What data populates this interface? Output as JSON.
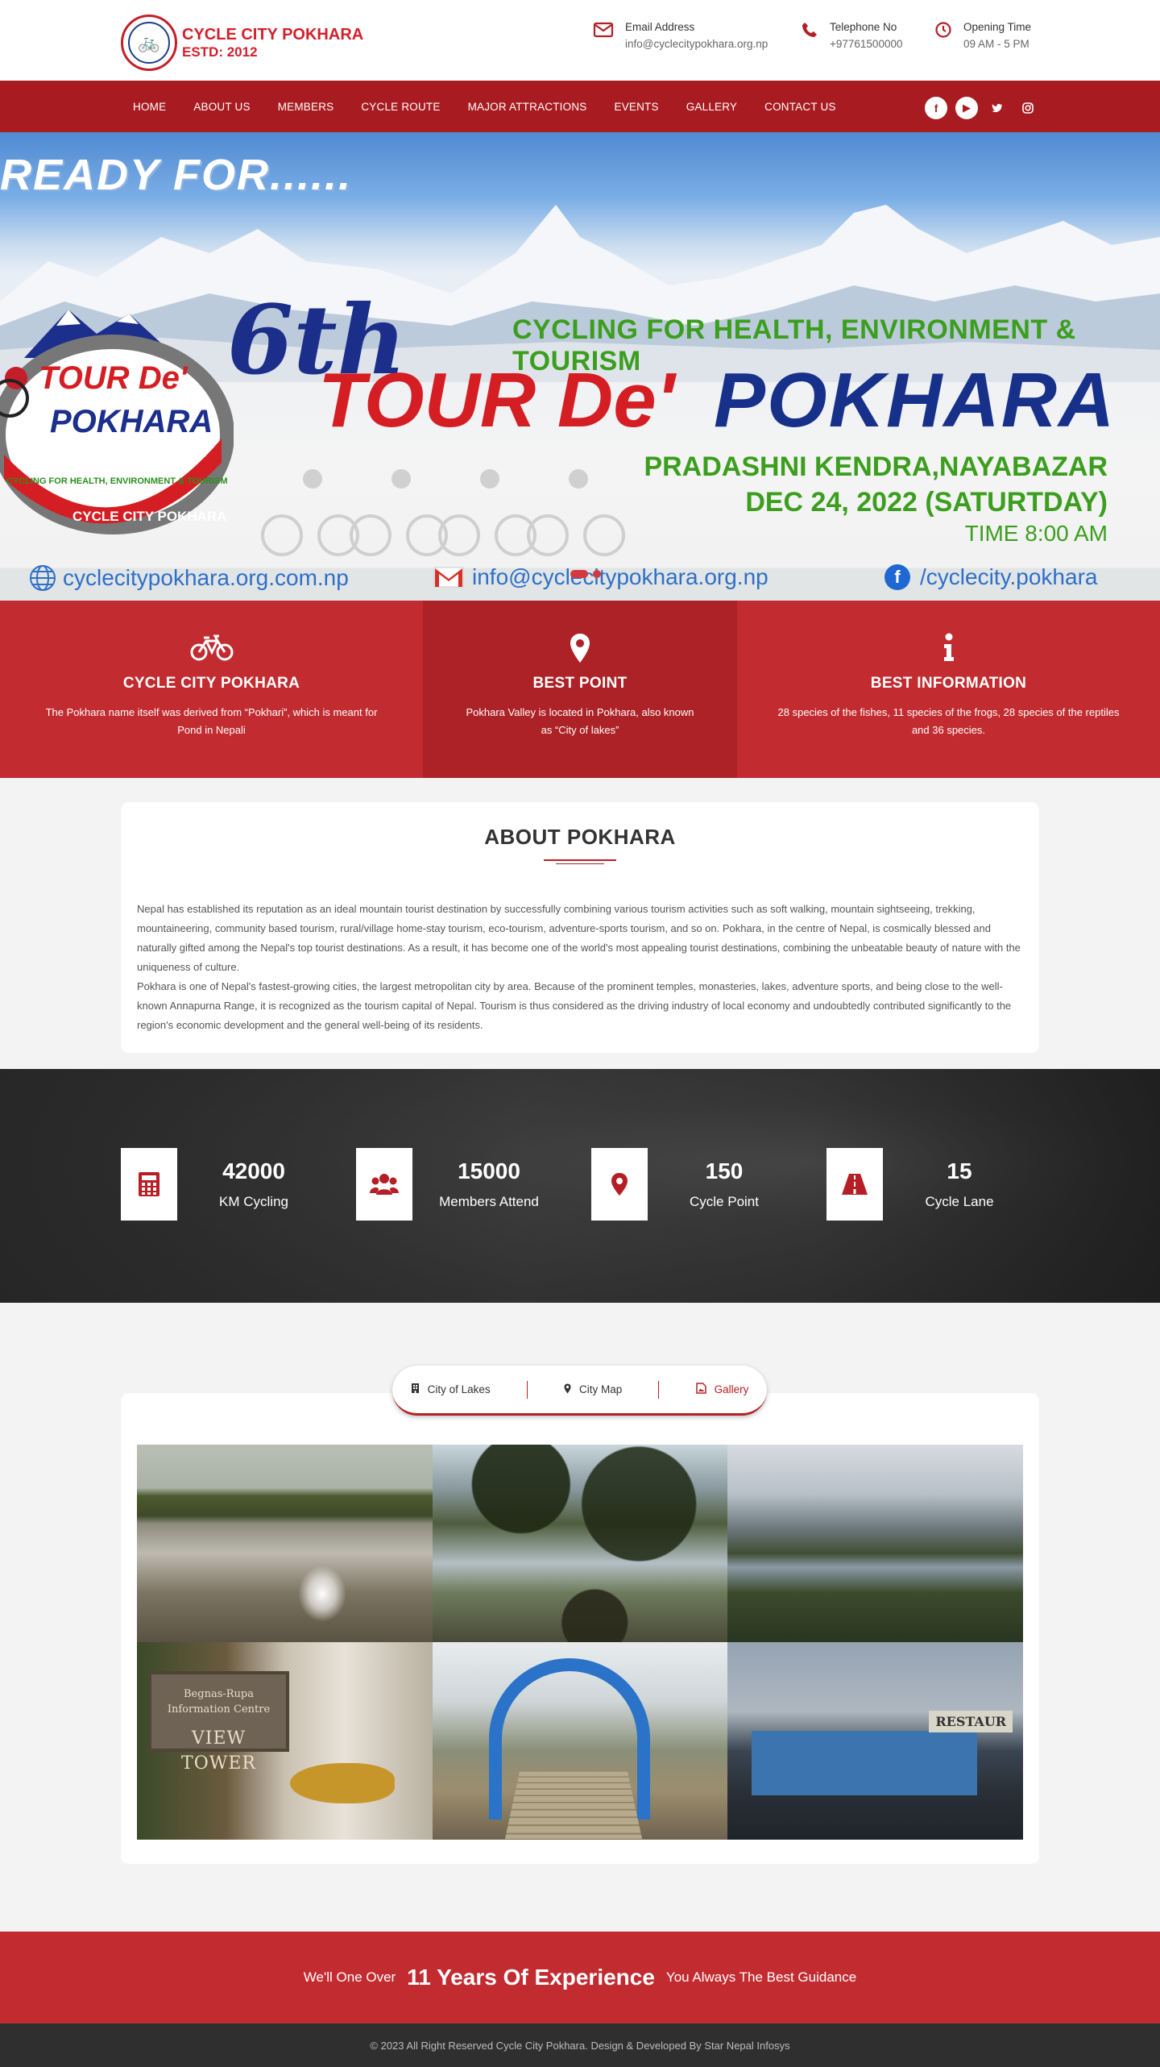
{
  "header": {
    "logo_line1": "CYCLE CITY POKHARA",
    "logo_line2": "ESTD: 2012",
    "contacts": [
      {
        "icon": "envelope-icon",
        "title": "Email Address",
        "value": "info@cyclecitypokhara.org.np"
      },
      {
        "icon": "phone-icon",
        "title": "Telephone No",
        "value": "+97761500000"
      },
      {
        "icon": "clock-icon",
        "title": "Opening Time",
        "value": "09 AM - 5 PM"
      }
    ]
  },
  "nav": {
    "items": [
      "HOME",
      "ABOUT US",
      "MEMBERS",
      "CYCLE ROUTE",
      "MAJOR ATTRACTIONS",
      "EVENTS",
      "GALLERY",
      "CONTACT US"
    ],
    "socials": [
      "facebook-icon",
      "youtube-icon",
      "twitter-icon",
      "instagram-icon"
    ]
  },
  "hero": {
    "ready": "READY FOR......",
    "tagline": "CYCLING FOR HEALTH, ENVIRONMENT & TOURISM",
    "edition": "6th",
    "title_red": "TOUR De'",
    "title_blue": "POKHARA",
    "venue": "PRADASHNI KENDRA,NAYABAZAR",
    "date": "DEC 24, 2022 (SATURTDAY)",
    "time": "TIME 8:00 AM",
    "emblem_top": "TOUR De'",
    "emblem_mid": "POKHARA",
    "emblem_ring": "CYCLING FOR HEALTH, ENVIRONMENT & TOURISM",
    "emblem_bottom": "CYCLE CITY POKHARA",
    "website": "cyclecitypokhara.org.com.np",
    "email": "info@cyclecitypokhara.org.np",
    "facebook": "/cyclecity.pokhara",
    "slides": 2,
    "active_slide": 1
  },
  "features": [
    {
      "icon": "bicycle-icon",
      "title": "CYCLE CITY POKHARA",
      "desc": "The Pokhara name itself was derived from “Pokhari”, which is meant for Pond in Nepali"
    },
    {
      "icon": "map-pin-icon",
      "title": "BEST POINT",
      "desc": "Pokhara Valley is located in Pokhara, also known as “City of lakes”"
    },
    {
      "icon": "info-icon",
      "title": "BEST INFORMATION",
      "desc": "28 species of the fishes, 11 species of the frogs, 28 species of the reptiles and 36 species."
    }
  ],
  "about": {
    "heading": "ABOUT POKHARA",
    "p1": "Nepal has established its reputation as an ideal mountain tourist destination by successfully combining various tourism activities such as soft walking, mountain sightseeing, trekking, mountaineering, community based tourism, rural/village home-stay tourism, eco-tourism, adventure-sports tourism, and so on. Pokhara, in the centre of Nepal, is cosmically blessed and naturally gifted among the Nepal's top tourist destinations. As a result, it has become one of the world's most appealing tourist destinations, combining the unbeatable beauty of nature with the uniqueness of culture.",
    "p2": "Pokhara is one of Nepal's fastest-growing cities, the largest metropolitan city by area. Because of the prominent temples, monasteries, lakes, adventure sports, and being close to the well-known Annapurna Range, it is recognized as the tourism capital of Nepal. Tourism is thus considered as the driving industry of local economy and undoubtedly contributed significantly to the region's economic development and the general well-being of its residents."
  },
  "stats": [
    {
      "icon": "calculator-icon",
      "value": "42000",
      "label": "KM Cycling"
    },
    {
      "icon": "users-icon",
      "value": "15000",
      "label": "Members Attend"
    },
    {
      "icon": "map-pin-icon",
      "value": "150",
      "label": "Cycle Point"
    },
    {
      "icon": "road-icon",
      "value": "15",
      "label": "Cycle Lane"
    }
  ],
  "gallery": {
    "tabs": [
      {
        "icon": "building-icon",
        "label": "City of Lakes"
      },
      {
        "icon": "map-pin-icon",
        "label": "City Map"
      },
      {
        "icon": "image-icon",
        "label": "Gallery"
      }
    ],
    "active_tab": "Gallery",
    "photo_texts": {
      "sign_small": "Begnas-Rupa\nInformation Centre",
      "sign_big": "VIEW TOWER",
      "restaurant": "RESTAUR"
    }
  },
  "footer": {
    "cta_pre": "We'll One Over",
    "cta_big": "11 Years Of Experience",
    "cta_post": "You Always The Best Guidance",
    "copyright": "© 2023 All Right Reserved Cycle City Pokhara. Design & Developed By Star Nepal Infosys"
  }
}
